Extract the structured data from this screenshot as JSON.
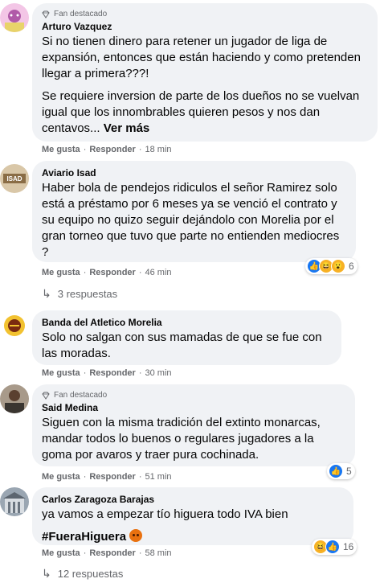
{
  "comments": [
    {
      "badge": "Fan destacado",
      "author": "Arturo Vazquez",
      "paragraphs": [
        "Si no tienen dinero para retener un jugador de liga de expansión, entonces que están haciendo y como pretenden llegar a primera???!",
        "Se requiere inversion de parte de los dueños no se vuelvan igual que los innombrables quieren pesos y nos dan centavos..."
      ],
      "see_more": "Ver más",
      "like": "Me gusta",
      "reply": "Responder",
      "time": "18 min"
    },
    {
      "author": "Aviario Isad",
      "paragraphs": [
        "Haber bola de pendejos ridiculos el señor Ramirez solo está a préstamo por 6 meses ya se venció el contrato y su equipo no quizo seguir dejándolo con Morelia por el gran torneo que tuvo que parte no entienden mediocres ?"
      ],
      "like": "Me gusta",
      "reply": "Responder",
      "time": "46 min",
      "reaction_count": "6",
      "replies_label": "3 respuestas"
    },
    {
      "author": "Banda del Atletico Morelia",
      "paragraphs": [
        "Solo no salgan con sus mamadas de que se fue con las moradas."
      ],
      "like": "Me gusta",
      "reply": "Responder",
      "time": "30 min"
    },
    {
      "badge": "Fan destacado",
      "author": "Said Medina",
      "paragraphs": [
        "Siguen con la misma tradición del extinto monarcas, mandar todos lo buenos o regulares jugadores a la goma por avaros y traer pura cochinada."
      ],
      "like": "Me gusta",
      "reply": "Responder",
      "time": "51 min",
      "reaction_count": "5"
    },
    {
      "author": "Carlos Zaragoza Barajas",
      "paragraphs": [
        "ya vamos a empezar tío higuera todo IVA bien"
      ],
      "hashtag": "#FueraHiguera",
      "like": "Me gusta",
      "reply": "Responder",
      "time": "58 min",
      "reaction_count": "16",
      "replies_label": "12 respuestas"
    }
  ],
  "separator": "·"
}
